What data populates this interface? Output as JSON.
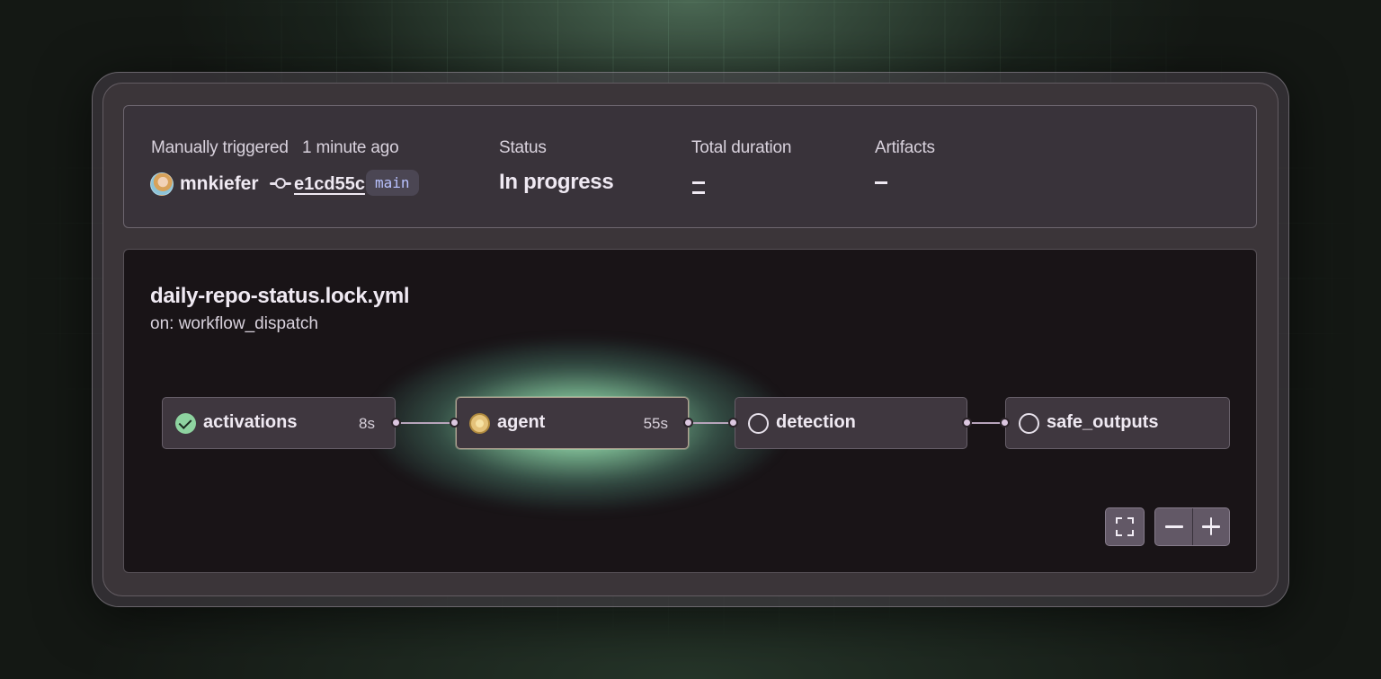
{
  "summary": {
    "trigger_label": "Manually triggered",
    "trigger_time": "1 minute ago",
    "user": "mnkiefer",
    "commit": "e1cd55c",
    "branch": "main",
    "status_label": "Status",
    "status_value": "In progress",
    "duration_label": "Total duration",
    "artifacts_label": "Artifacts"
  },
  "workflow": {
    "file": "daily-repo-status.lock.yml",
    "trigger": "on: workflow_dispatch",
    "jobs": [
      {
        "name": "activations",
        "duration": "8s",
        "status": "success"
      },
      {
        "name": "agent",
        "duration": "55s",
        "status": "in_progress"
      },
      {
        "name": "detection",
        "duration": "",
        "status": "pending"
      },
      {
        "name": "safe_outputs",
        "duration": "",
        "status": "pending"
      }
    ]
  },
  "controls": {
    "fit_icon": "fullscreen-icon",
    "zoom_out_icon": "minus-icon",
    "zoom_in_icon": "plus-icon"
  },
  "colors": {
    "success": "#8ed3a0",
    "in_progress": "#e4c27a",
    "branch_text": "#b9c2ff",
    "glow": "#a8f0c0"
  }
}
